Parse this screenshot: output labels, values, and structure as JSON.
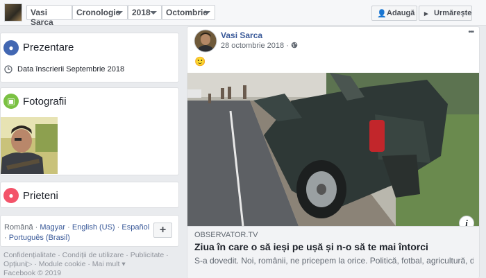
{
  "topbar": {
    "name_dropdown": "Vasi Sarca",
    "section_dropdown": "Cronologie",
    "year_dropdown": "2018",
    "month_dropdown": "Octombrie",
    "add_button": "Adaugă",
    "follow_button": "Urmărește"
  },
  "intro": {
    "title": "Prezentare",
    "joined": "Data înscrierii Septembrie 2018"
  },
  "photos": {
    "title": "Fotografii"
  },
  "friends": {
    "title": "Prieteni"
  },
  "languages": {
    "current": "Română",
    "options": [
      "Magyar",
      "English (US)",
      "Español",
      "Português (Brasil)"
    ],
    "add_label": "+"
  },
  "footer": {
    "links": [
      "Confidențialitate",
      "Condiții de utilizare",
      "Publicitate",
      "Opțiuni",
      "Module cookie",
      "Mai mult"
    ],
    "copyright": "Facebook © 2019"
  },
  "post": {
    "author": "Vasi Sarca",
    "date": "28 octombrie 2018",
    "emoji": "🙂",
    "more": "•••",
    "link": {
      "domain": "OBSERVATOR.TV",
      "title": "Ziua în care o să ieși pe ușă și n-o să te mai întorci",
      "description": "S-a dovedit. Noi, românii, ne pricepem la orice. Politică, fotbal, agricultură, d...",
      "info": "i"
    }
  }
}
